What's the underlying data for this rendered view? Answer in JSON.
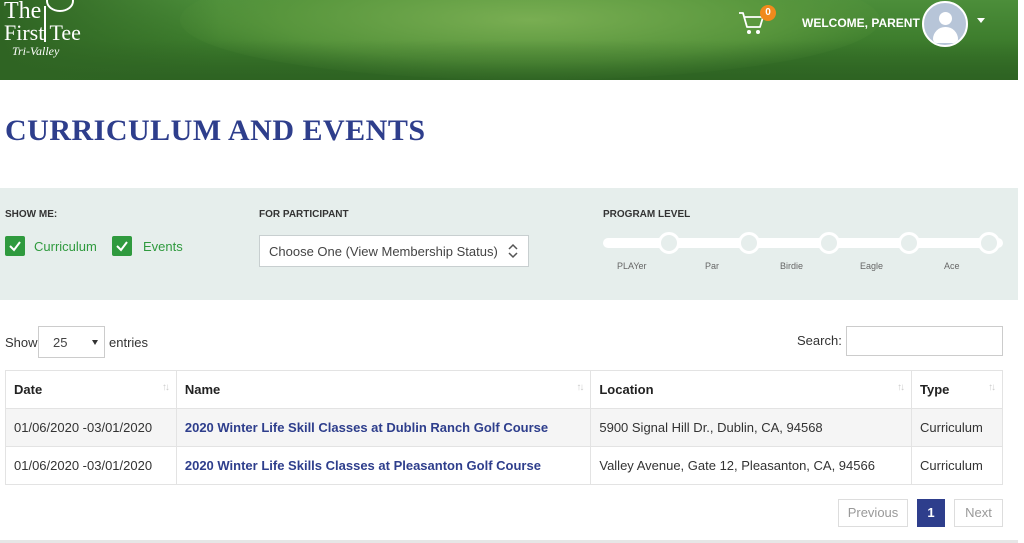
{
  "header": {
    "logo": {
      "line1": "The",
      "line2": "First Tee",
      "line3": "Tri-Valley"
    },
    "cart_count": "0",
    "welcome": "WELCOME, PARENT"
  },
  "page_title": "CURRICULUM AND EVENTS",
  "filters": {
    "show_me_label": "SHOW ME:",
    "curriculum_label": "Curriculum",
    "events_label": "Events",
    "participant_label": "FOR PARTICIPANT",
    "participant_value": "Choose One (View Membership Status)",
    "program_level_label": "PROGRAM LEVEL",
    "levels": [
      "PLAYer",
      "Par",
      "Birdie",
      "Eagle",
      "Ace"
    ]
  },
  "table_controls": {
    "show": "Show",
    "entries_value": "25",
    "entries": "entries",
    "search_label": "Search:"
  },
  "table": {
    "columns": [
      "Date",
      "Name",
      "Location",
      "Type"
    ],
    "rows": [
      {
        "date": "01/06/2020 -03/01/2020",
        "name": "2020 Winter Life Skill Classes at Dublin Ranch Golf Course",
        "location": "5900 Signal Hill Dr., Dublin, CA, 94568",
        "type": "Curriculum"
      },
      {
        "date": "01/06/2020 -03/01/2020",
        "name": "2020 Winter Life Skills Classes at Pleasanton Golf Course",
        "location": "Valley Avenue, Gate 12, Pleasanton, CA, 94566",
        "type": "Curriculum"
      }
    ]
  },
  "pagination": {
    "previous": "Previous",
    "page": "1",
    "next": "Next"
  },
  "colors": {
    "brand_blue": "#2e3e8c",
    "check_green": "#2f9a3e",
    "badge_orange": "#f08a1c"
  }
}
